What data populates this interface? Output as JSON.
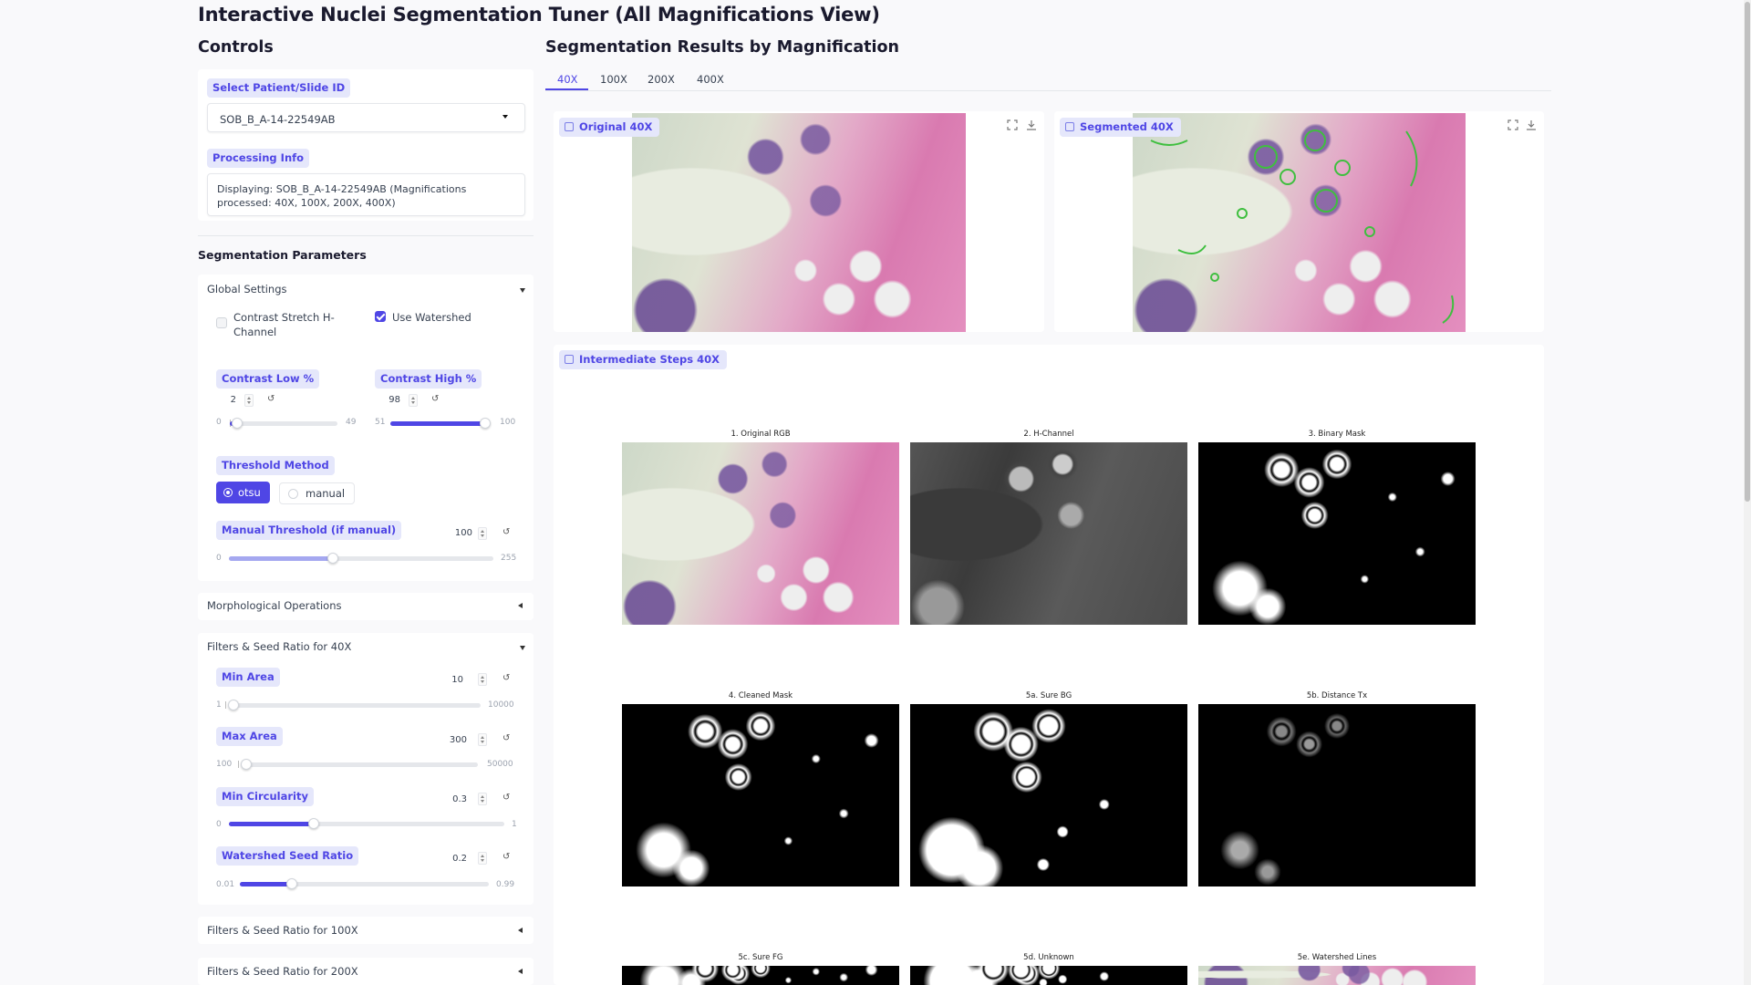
{
  "app": {
    "title": "Interactive Nuclei Segmentation Tuner (All Magnifications View)"
  },
  "controls": {
    "heading": "Controls",
    "patient_label": "Select Patient/Slide ID",
    "patient_value": "SOB_B_A-14-22549AB",
    "processing_label": "Processing Info",
    "processing_text": "Displaying: SOB_B_A-14-22549AB (Magnifications processed: 40X, 100X, 200X, 400X)"
  },
  "params": {
    "heading": "Segmentation Parameters",
    "global": {
      "title": "Global Settings",
      "contrast_stretch_label": "Contrast Stretch H-Channel",
      "contrast_stretch_checked": false,
      "use_watershed_label": "Use Watershed",
      "use_watershed_checked": true,
      "contrast_low": {
        "label": "Contrast Low %",
        "value": "2",
        "min": "0",
        "max": "49",
        "fraction": 0.04
      },
      "contrast_high": {
        "label": "Contrast High %",
        "value": "98",
        "min": "51",
        "max": "100",
        "fraction": 0.96
      },
      "threshold_method": {
        "label": "Threshold Method",
        "options": [
          "otsu",
          "manual"
        ],
        "selected": "otsu"
      },
      "manual_threshold": {
        "label": "Manual Threshold (if manual)",
        "value": "100",
        "min": "0",
        "max": "255",
        "fraction": 0.39
      }
    },
    "morph": {
      "title": "Morphological Operations"
    },
    "filters40": {
      "title": "Filters & Seed Ratio for 40X",
      "min_area": {
        "label": "Min Area",
        "value": "10",
        "min": "1",
        "max": "10000",
        "fraction": 0.001
      },
      "max_area": {
        "label": "Max Area",
        "value": "300",
        "min": "100",
        "max": "50000",
        "fraction": 0.004
      },
      "min_circularity": {
        "label": "Min Circularity",
        "value": "0.3",
        "min": "0",
        "max": "1",
        "fraction": 0.3
      },
      "seed_ratio": {
        "label": "Watershed Seed Ratio",
        "value": "0.2",
        "min": "0.01",
        "max": "0.99",
        "fraction": 0.19
      }
    },
    "filters100": {
      "title": "Filters & Seed Ratio for 100X"
    },
    "filters200": {
      "title": "Filters & Seed Ratio for 200X"
    }
  },
  "results": {
    "heading": "Segmentation Results by Magnification",
    "tabs": [
      "40X",
      "100X",
      "200X",
      "400X"
    ],
    "active_tab": "40X",
    "original_label": "Original 40X",
    "segmented_label": "Segmented 40X",
    "intermediate_label": "Intermediate Steps 40X",
    "steps": [
      "1. Original RGB",
      "2. H-Channel",
      "3. Binary Mask",
      "4. Cleaned Mask",
      "5a. Sure BG",
      "5b. Distance Tx",
      "5c. Sure FG",
      "5d. Unknown",
      "5e. Watershed Lines"
    ]
  },
  "colors": {
    "accent": "#4f46e5",
    "badge_bg": "#e5e7fb"
  }
}
